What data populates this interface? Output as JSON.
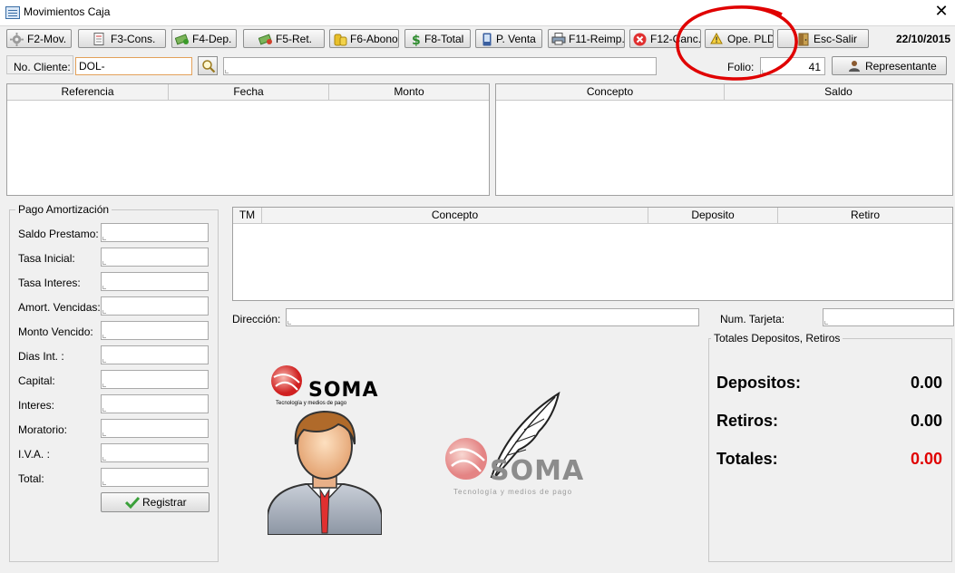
{
  "window": {
    "title": "Movimientos Caja",
    "close_glyph": "✕"
  },
  "toolbar": {
    "buttons": [
      {
        "label": "F2-Mov.",
        "icon": "gear-icon"
      },
      {
        "label": "F3-Cons.",
        "icon": "document-icon"
      },
      {
        "label": "F4-Dep.",
        "icon": "money-deposit-icon"
      },
      {
        "label": "F5-Ret.",
        "icon": "money-withdraw-icon"
      },
      {
        "label": "F6-Abono",
        "icon": "coins-icon"
      },
      {
        "label": "F8-Total",
        "icon": "dollar-icon"
      },
      {
        "label": "P. Venta",
        "icon": "phone-icon"
      },
      {
        "label": "F11-Reimp.",
        "icon": "printer-icon"
      },
      {
        "label": "F12-Canc.",
        "icon": "cancel-icon"
      },
      {
        "label": "Ope. PLD",
        "icon": "warning-icon"
      },
      {
        "label": "Esc-Salir",
        "icon": "exit-door-icon"
      }
    ],
    "date": "22/10/2015"
  },
  "client": {
    "label": "No. Cliente:",
    "value": "DOL-",
    "name_value": "",
    "folio_label": "Folio:",
    "folio_value": "41",
    "rep_button": "Representante"
  },
  "grid_left": {
    "columns": [
      "Referencia",
      "Fecha",
      "Monto"
    ]
  },
  "grid_right": {
    "columns": [
      "Concepto",
      "Saldo"
    ]
  },
  "pago": {
    "title": "Pago Amortización",
    "fields": [
      "Saldo Prestamo:",
      "Tasa Inicial:",
      "Tasa Interes:",
      "Amort. Vencidas:",
      "Monto Vencido:",
      "Dias Int. :",
      "Capital:",
      "Interes:",
      "Moratorio:",
      "I.V.A. :",
      "Total:"
    ],
    "register_button": "Registrar"
  },
  "mov_grid": {
    "columns": [
      "TM",
      "Concepto",
      "Deposito",
      "Retiro"
    ]
  },
  "direccion": {
    "label": "Dirección:",
    "value": ""
  },
  "tarjeta": {
    "label": "Num. Tarjeta:",
    "value": ""
  },
  "logo": {
    "brand": "SOMA",
    "tagline": "Tecnología y medios de pago"
  },
  "totales": {
    "title": "Totales Depositos, Retiros",
    "depositos_label": "Depositos:",
    "depositos_value": "0.00",
    "retiros_label": "Retiros:",
    "retiros_value": "0.00",
    "totales_label": "Totales:",
    "totales_value": "0.00",
    "totales_color": "#e00000"
  },
  "annotation": {
    "color": "#e00000"
  }
}
